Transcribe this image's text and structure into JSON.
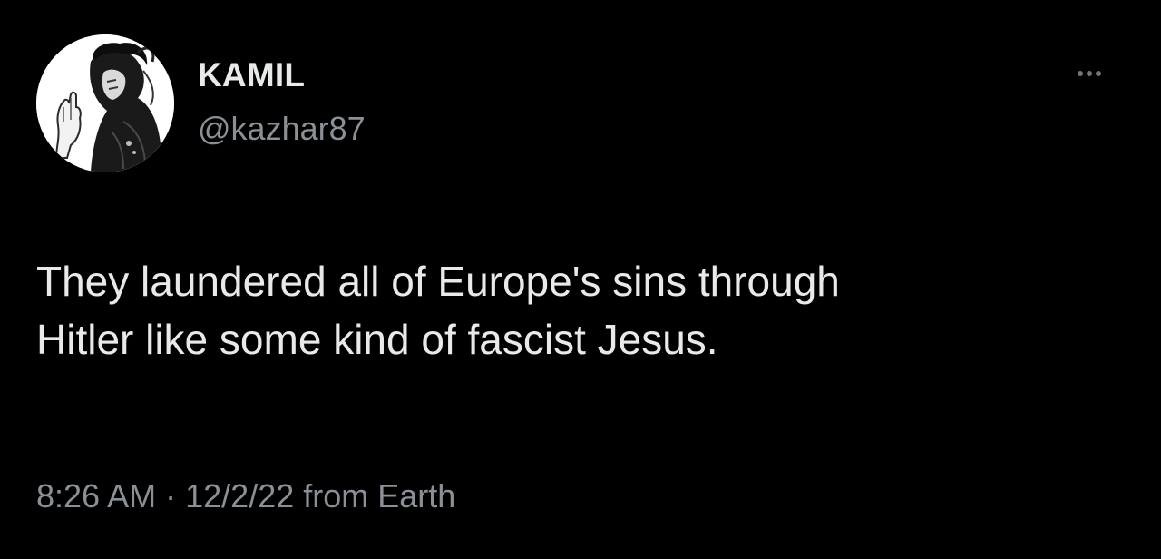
{
  "author": {
    "display_name": "KAMIL",
    "handle": "@kazhar87",
    "avatar_icon": "profile-avatar-illustration"
  },
  "more_icon": "more-horizontal-icon",
  "tweet": {
    "text_lines": [
      "They laundered all of Europe's sins through",
      "Hitler like some kind of fascist Jesus."
    ],
    "time": "8:26 AM",
    "separator": "·",
    "date": "12/2/22",
    "source": "from Earth"
  },
  "colors": {
    "background": "#000000",
    "primary_text": "#e7e9ea",
    "secondary_text": "#8b9096"
  }
}
